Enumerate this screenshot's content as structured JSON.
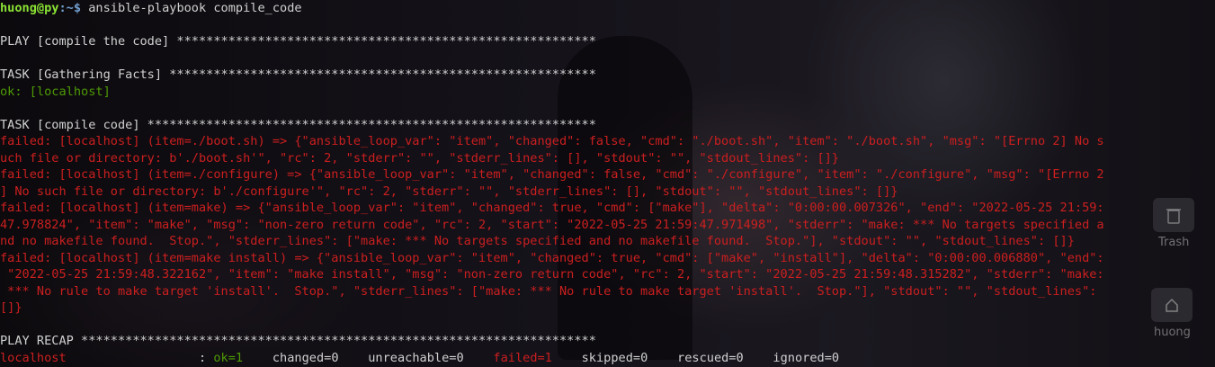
{
  "terminal": {
    "prompt_user": "huong@py",
    "prompt_path": ":~$",
    "command": " ansible-playbook compile_code",
    "play_line": "PLAY [compile the code] *********************************************************",
    "task_facts": "TASK [Gathering Facts] **********************************************************",
    "ok_localhost": "ok: [localhost]",
    "task_compile": "TASK [compile code] *************************************************************",
    "errors": [
      "failed: [localhost] (item=./boot.sh) => {\"ansible_loop_var\": \"item\", \"changed\": false, \"cmd\": \"./boot.sh\", \"item\": \"./boot.sh\", \"msg\": \"[Errno 2] No s",
      "uch file or directory: b'./boot.sh'\", \"rc\": 2, \"stderr\": \"\", \"stderr_lines\": [], \"stdout\": \"\", \"stdout_lines\": []}",
      "failed: [localhost] (item=./configure) => {\"ansible_loop_var\": \"item\", \"changed\": false, \"cmd\": \"./configure\", \"item\": \"./configure\", \"msg\": \"[Errno 2",
      "] No such file or directory: b'./configure'\", \"rc\": 2, \"stderr\": \"\", \"stderr_lines\": [], \"stdout\": \"\", \"stdout_lines\": []}",
      "failed: [localhost] (item=make) => {\"ansible_loop_var\": \"item\", \"changed\": true, \"cmd\": [\"make\"], \"delta\": \"0:00:00.007326\", \"end\": \"2022-05-25 21:59:",
      "47.978824\", \"item\": \"make\", \"msg\": \"non-zero return code\", \"rc\": 2, \"start\": \"2022-05-25 21:59:47.971498\", \"stderr\": \"make: *** No targets specified a",
      "nd no makefile found.  Stop.\", \"stderr_lines\": [\"make: *** No targets specified and no makefile found.  Stop.\"], \"stdout\": \"\", \"stdout_lines\": []}",
      "failed: [localhost] (item=make install) => {\"ansible_loop_var\": \"item\", \"changed\": true, \"cmd\": [\"make\", \"install\"], \"delta\": \"0:00:00.006880\", \"end\":",
      " \"2022-05-25 21:59:48.322162\", \"item\": \"make install\", \"msg\": \"non-zero return code\", \"rc\": 2, \"start\": \"2022-05-25 21:59:48.315282\", \"stderr\": \"make:",
      " *** No rule to make target 'install'.  Stop.\", \"stderr_lines\": [\"make: *** No rule to make target 'install'.  Stop.\"], \"stdout\": \"\", \"stdout_lines\":",
      "[]}"
    ],
    "recap_line": "PLAY RECAP **********************************************************************",
    "recap": {
      "host": "localhost",
      "separator": "                  : ",
      "ok": "ok=1",
      "changed": "    changed=0",
      "unreachable": "    unreachable=0",
      "failed": "    failed=1",
      "skipped": "    skipped=0",
      "rescued": "    rescued=0",
      "ignored": "    ignored=0"
    }
  },
  "desktop": {
    "trash_label": "Trash",
    "home_label": "huong"
  }
}
